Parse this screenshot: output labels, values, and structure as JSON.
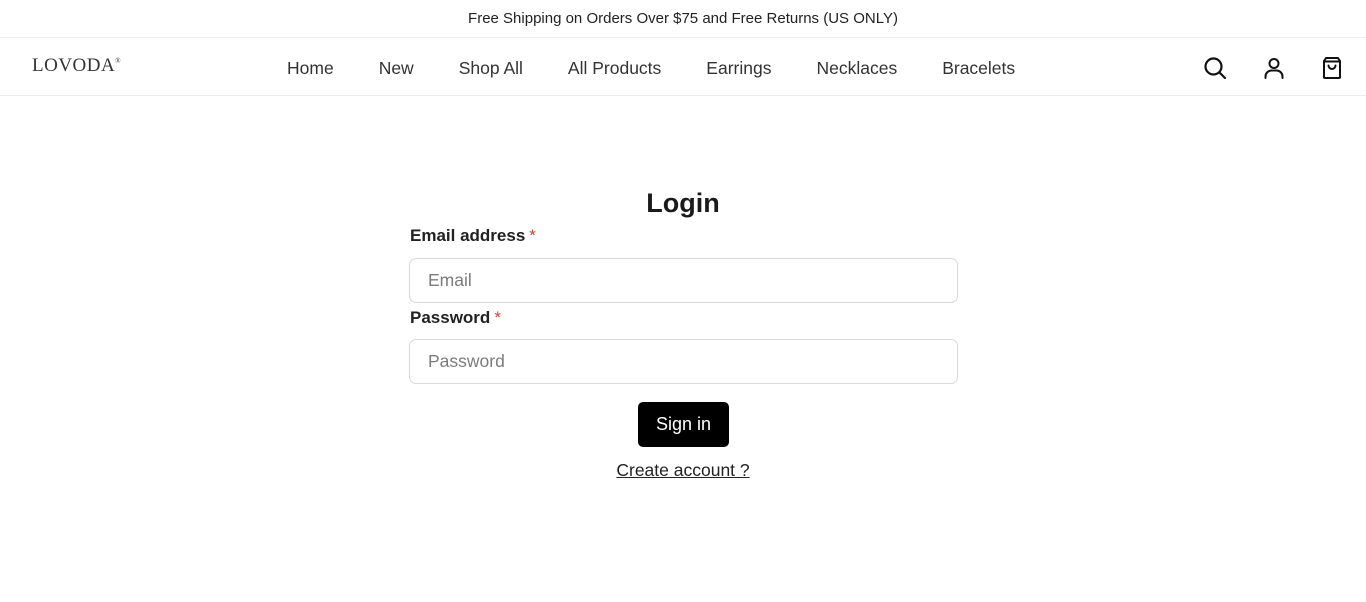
{
  "announcement": {
    "text": "Free Shipping on Orders Over $75 and Free Returns (US ONLY)"
  },
  "header": {
    "logo": "LOVODA",
    "nav": [
      {
        "label": "Home"
      },
      {
        "label": "New"
      },
      {
        "label": "Shop All"
      },
      {
        "label": "All Products"
      },
      {
        "label": "Earrings"
      },
      {
        "label": "Necklaces"
      },
      {
        "label": "Bracelets"
      }
    ],
    "icons": {
      "search": "search-icon",
      "account": "user-icon",
      "cart": "shopping-bag-icon"
    }
  },
  "login": {
    "title": "Login",
    "email_label": "Email address",
    "email_placeholder": "Email",
    "email_value": "",
    "password_label": "Password",
    "password_placeholder": "Password",
    "password_value": "",
    "required_marker": "*",
    "submit_label": "Sign in",
    "create_account_label": "Create account ?"
  },
  "colors": {
    "required": "#e03a3a",
    "button_bg": "#000000",
    "button_text": "#ffffff"
  }
}
